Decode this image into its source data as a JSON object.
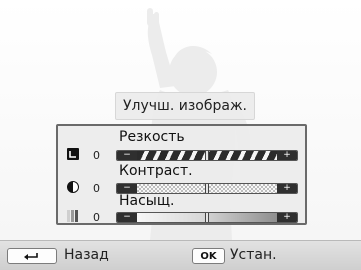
{
  "title": "Улучш. изображ.",
  "adjustments": [
    {
      "label": "Резкость",
      "value": "0",
      "icon": "sharpness-icon",
      "level": 0.5
    },
    {
      "label": "Контраст.",
      "value": "0",
      "icon": "contrast-icon",
      "level": 0.5
    },
    {
      "label": "Насыщ.",
      "value": "0",
      "icon": "saturation-icon",
      "level": 0.5
    }
  ],
  "slider": {
    "minus": "−",
    "plus": "+"
  },
  "footer": {
    "back_icon": "return-arrow-icon",
    "back_label": "Назад",
    "ok_key": "OK",
    "ok_label": "Устан."
  }
}
